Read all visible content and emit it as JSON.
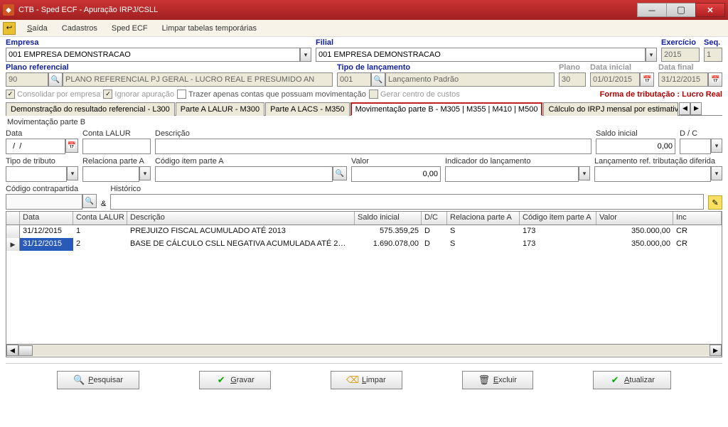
{
  "window": {
    "title": "CTB - Sped ECF - Apuração IRPJ/CSLL"
  },
  "menubar": {
    "saida": "Saída",
    "cadastros": "Cadastros",
    "sped": "Sped ECF",
    "limpar": "Limpar tabelas temporárias"
  },
  "header": {
    "empresa_label": "Empresa",
    "empresa_value": "001 EMPRESA DEMONSTRACAO",
    "filial_label": "Filial",
    "filial_value": "001 EMPRESA DEMONSTRACAO",
    "exercicio_label": "Exercício",
    "exercicio_value": "2015",
    "seq_label": "Seq.",
    "seq_value": "1",
    "plano_ref_label": "Plano referencial",
    "plano_ref_code": "90",
    "plano_ref_desc": "PLANO REFERENCIAL PJ GERAL - LUCRO REAL E PRESUMIDO AN",
    "tipo_lanc_label": "Tipo de lançamento",
    "tipo_lanc_code": "001",
    "tipo_lanc_desc": "Lançamento Padrão",
    "plano_label": "Plano",
    "plano_value": "30",
    "data_ini_label": "Data inicial",
    "data_ini_value": "01/01/2015",
    "data_fin_label": "Data final",
    "data_fin_value": "31/12/2015"
  },
  "checks": {
    "consolidar": "Consolidar por empresa",
    "ignorar": "Ignorar apuração",
    "trazer": "Trazer apenas contas que possuam movimentação",
    "gerar": "Gerar centro de custos",
    "forma": "Forma de tributação : Lucro Real"
  },
  "tabs": {
    "t1": "Demonstração do resultado referencial - L300",
    "t2": "Parte A LALUR - M300",
    "t3": "Parte A LACS - M350",
    "t4": "Movimentação parte B - M305 | M355 | M410 | M500",
    "t5": "Cálculo do IRPJ mensal por estimativas"
  },
  "parteB": {
    "fieldset": "Movimentação parte B",
    "data_label": "Data",
    "data_value": "  /  /",
    "conta_label": "Conta LALUR",
    "descricao_label": "Descrição",
    "saldo_label": "Saldo inicial",
    "saldo_value": "0,00",
    "dc_label": "D / C",
    "tipo_trib_label": "Tipo de tributo",
    "rel_a_label": "Relaciona parte A",
    "cod_item_label": "Código item parte A",
    "valor_label": "Valor",
    "valor_value": "0,00",
    "indicador_label": "Indicador do lançamento",
    "lanc_ref_label": "Lançamento ref. tributação diferida",
    "cod_contra_label": "Código contrapartida",
    "historico_label": "Histórico"
  },
  "grid": {
    "columns": {
      "data": "Data",
      "conta": "Conta LALUR",
      "desc": "Descrição",
      "saldo": "Saldo inicial",
      "dc": "D/C",
      "rel": "Relaciona parte A",
      "cod": "Código item parte A",
      "valor": "Valor",
      "ind": "Inc"
    },
    "rows": [
      {
        "data": "31/12/2015",
        "conta": "1",
        "desc": "PREJUIZO FISCAL ACUMULADO ATÉ 2013",
        "saldo": "575.359,25",
        "dc": "D",
        "rel": "S",
        "cod": "173",
        "valor": "350.000,00",
        "ind": "CR"
      },
      {
        "data": "31/12/2015",
        "conta": "2",
        "desc": "BASE DE CÁLCULO CSLL NEGATIVA ACUMULADA ATÉ 2…",
        "saldo": "1.690.078,00",
        "dc": "D",
        "rel": "S",
        "cod": "173",
        "valor": "350.000,00",
        "ind": "CR"
      }
    ]
  },
  "buttons": {
    "pesquisar": "Pesquisar",
    "gravar": "Gravar",
    "limpar": "Limpar",
    "excluir": "Excluir",
    "atualizar": "Atualizar"
  }
}
